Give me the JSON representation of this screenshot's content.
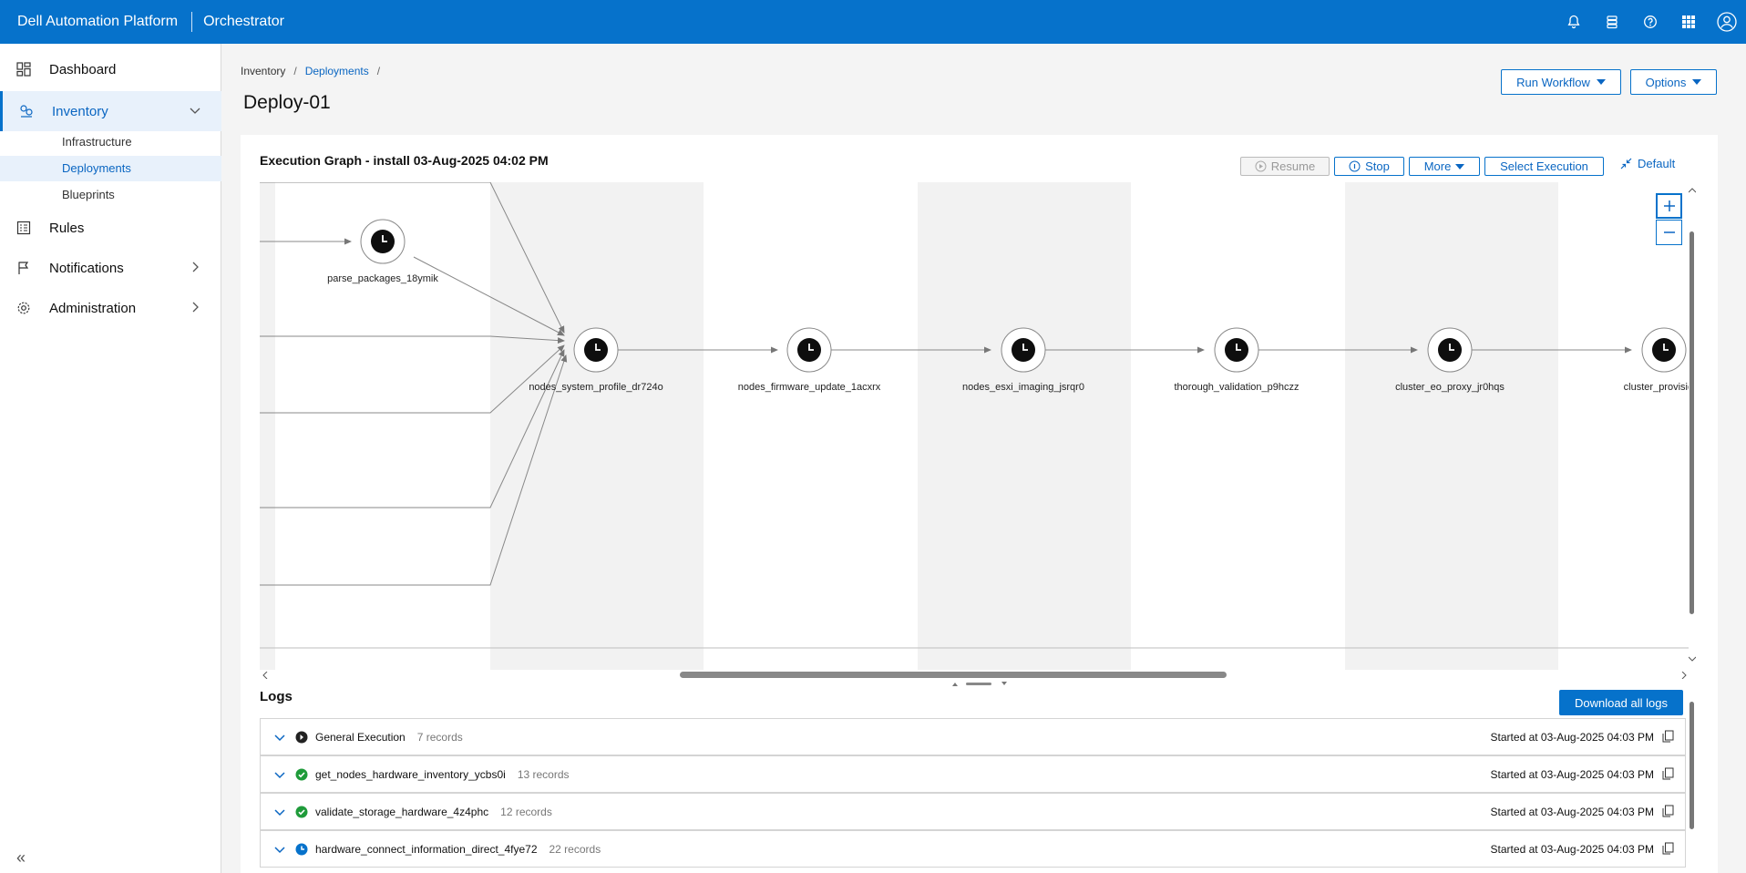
{
  "header": {
    "brand": "Dell Automation Platform",
    "app_name": "Orchestrator",
    "icons": [
      "bell-icon",
      "stack-icon",
      "help-icon",
      "apps-grid-icon",
      "user-avatar-icon"
    ],
    "accent_color": "#0672cb"
  },
  "sidebar": {
    "items": [
      {
        "label": "Dashboard",
        "icon": "dashboard-icon"
      },
      {
        "label": "Inventory",
        "icon": "inventory-icon",
        "expanded": true,
        "active": true
      },
      {
        "label": "Rules",
        "icon": "rules-icon"
      },
      {
        "label": "Notifications",
        "icon": "flag-icon"
      },
      {
        "label": "Administration",
        "icon": "gear-icon"
      }
    ],
    "sub_items": [
      {
        "label": "Infrastructure"
      },
      {
        "label": "Deployments",
        "active": true
      },
      {
        "label": "Blueprints"
      }
    ]
  },
  "breadcrumb": {
    "root": "Inventory",
    "link": "Deployments",
    "separator": "/"
  },
  "page": {
    "title": "Deploy-01",
    "run_workflow": "Run Workflow",
    "options": "Options"
  },
  "graph": {
    "title": "Execution Graph - install 03-Aug-2025 04:02 PM",
    "buttons": {
      "resume": "Resume",
      "stop": "Stop",
      "more": "More",
      "select_execution": "Select Execution",
      "default": "Default"
    },
    "nodes": [
      {
        "label": "parse_packages_18ymik",
        "status": "clock-icon"
      },
      {
        "label": "nodes_system_profile_dr724o",
        "status": "clock-icon"
      },
      {
        "label": "nodes_firmware_update_1acxrx",
        "status": "clock-icon"
      },
      {
        "label": "nodes_esxi_imaging_jsrqr0",
        "status": "clock-icon"
      },
      {
        "label": "thorough_validation_p9hczz",
        "status": "clock-icon"
      },
      {
        "label": "cluster_eo_proxy_jr0hqs",
        "status": "clock-icon"
      },
      {
        "label": "cluster_provision_",
        "status": "clock-icon"
      }
    ]
  },
  "logs": {
    "title": "Logs",
    "download_all": "Download all logs",
    "rows": [
      {
        "name": "General Execution",
        "count": "7 records",
        "started": "Started at 03-Aug-2025 04:03 PM",
        "status": "running-icon",
        "status_color": "#222222"
      },
      {
        "name": "get_nodes_hardware_inventory_ycbs0i",
        "count": "13 records",
        "started": "Started at 03-Aug-2025 04:03 PM",
        "status": "success-icon",
        "status_color": "#1f9b3a"
      },
      {
        "name": "validate_storage_hardware_4z4phc",
        "count": "12 records",
        "started": "Started at 03-Aug-2025 04:03 PM",
        "status": "success-icon",
        "status_color": "#1f9b3a"
      },
      {
        "name": "hardware_connect_information_direct_4fye72",
        "count": "22 records",
        "started": "Started at 03-Aug-2025 04:03 PM",
        "status": "in-progress-icon",
        "status_color": "#0672cb"
      }
    ]
  }
}
